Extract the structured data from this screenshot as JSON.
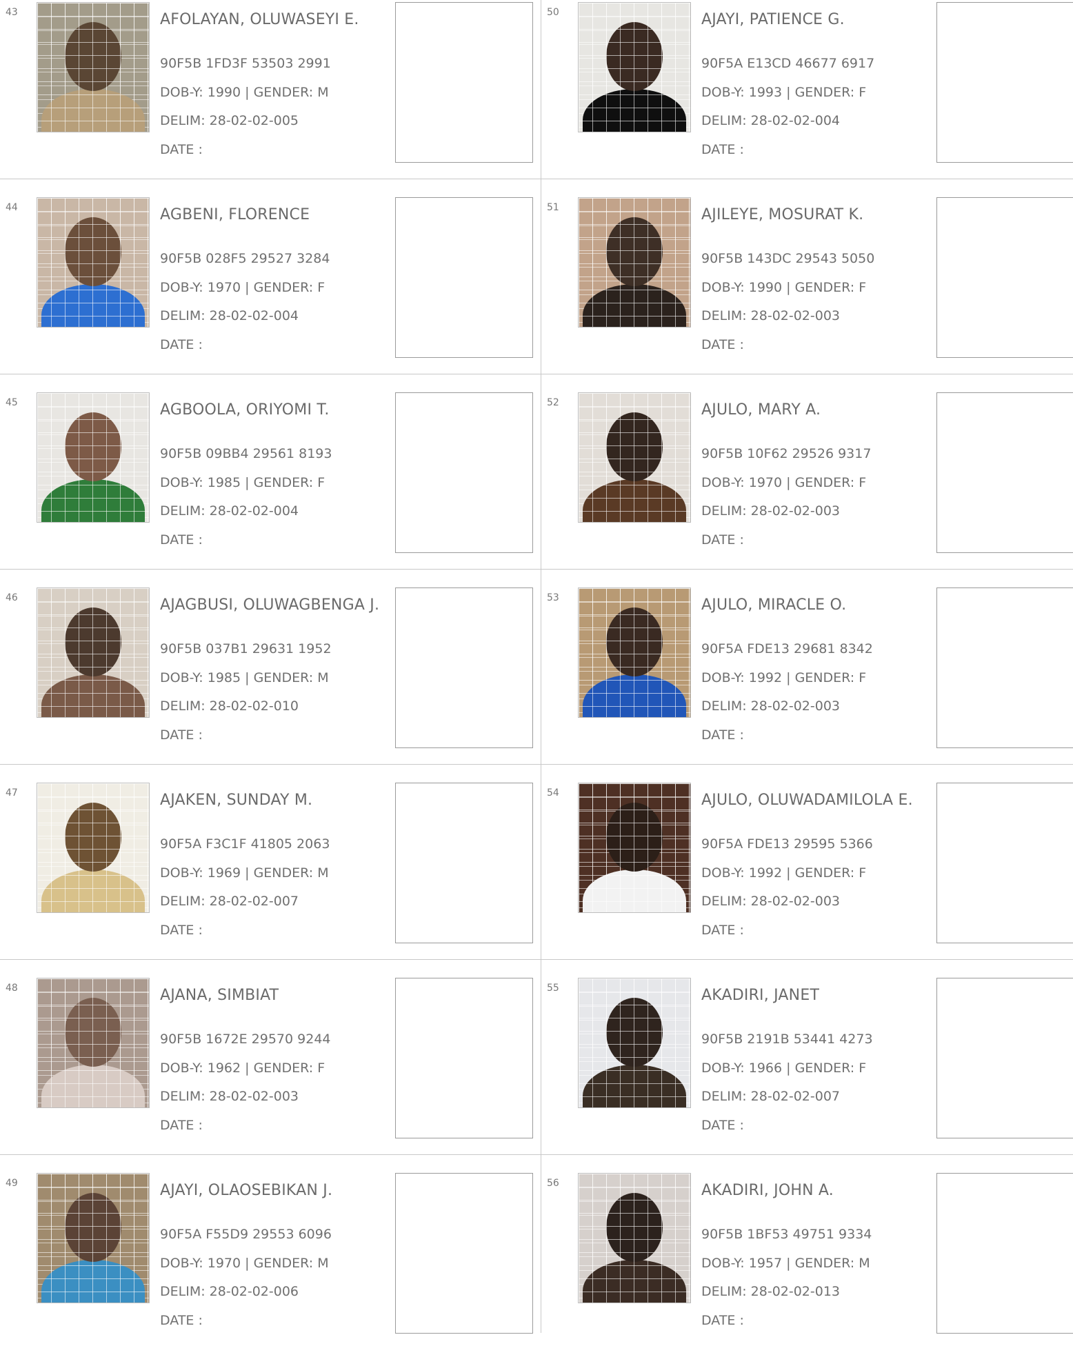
{
  "records": [
    {
      "num": "43",
      "name": "AFOLAYAN, OLUWASEYI E.",
      "vin": "90F5B 1FD3F 53503 2991",
      "dob": "DOB-Y: 1990  | GENDER: M",
      "delim": "DELIM: 28-02-02-005",
      "date": "DATE  :",
      "bg": "#a39c8a",
      "skin": "#5a4634",
      "cloth": "#b79f7a"
    },
    {
      "num": "44",
      "name": "AGBENI, FLORENCE",
      "vin": "90F5B 028F5 29527 3284",
      "dob": "DOB-Y: 1970  | GENDER: F",
      "delim": "DELIM: 28-02-02-004",
      "date": "DATE  :",
      "bg": "#c9b7a6",
      "skin": "#6b4f3b",
      "cloth": "#2d6fd1"
    },
    {
      "num": "45",
      "name": "AGBOOLA, ORIYOMI T.",
      "vin": "90F5B 09BB4 29561 8193",
      "dob": "DOB-Y: 1985  | GENDER: F",
      "delim": "DELIM: 28-02-02-004",
      "date": "DATE  :",
      "bg": "#e8e6e2",
      "skin": "#7d5a47",
      "cloth": "#2f7d3a"
    },
    {
      "num": "46",
      "name": "AJAGBUSI, OLUWAGBENGA J.",
      "vin": "90F5B 037B1 29631 1952",
      "dob": "DOB-Y: 1985  | GENDER: M",
      "delim": "DELIM: 28-02-02-010",
      "date": "DATE  :",
      "bg": "#d8cfc4",
      "skin": "#4c3a2e",
      "cloth": "#7a5a48"
    },
    {
      "num": "47",
      "name": "AJAKEN, SUNDAY M.",
      "vin": "90F5A F3C1F 41805 2063",
      "dob": "DOB-Y: 1969  | GENDER: M",
      "delim": "DELIM: 28-02-02-007",
      "date": "DATE  :",
      "bg": "#f0ede4",
      "skin": "#6e5234",
      "cloth": "#d8c18a"
    },
    {
      "num": "48",
      "name": "AJANA, SIMBIAT",
      "vin": "90F5B 1672E 29570 9244",
      "dob": "DOB-Y: 1962  | GENDER: F",
      "delim": "DELIM: 28-02-02-003",
      "date": "DATE  :",
      "bg": "#ab9a8f",
      "skin": "#7a5f50",
      "cloth": "#d8cbc4"
    },
    {
      "num": "49",
      "name": "AJAYI, OLAOSEBIKAN J.",
      "vin": "90F5A F55D9 29553 6096",
      "dob": "DOB-Y: 1970  | GENDER: M",
      "delim": "DELIM: 28-02-02-006",
      "date": "DATE  :",
      "bg": "#a08b6e",
      "skin": "#5b4336",
      "cloth": "#3b8fc2"
    },
    {
      "num": "50",
      "name": "AJAYI, PATIENCE G.",
      "vin": "90F5A E13CD 46677 6917",
      "dob": "DOB-Y: 1993  | GENDER: F",
      "delim": "DELIM: 28-02-02-004",
      "date": "DATE  :",
      "bg": "#e7e6e2",
      "skin": "#3a2a22",
      "cloth": "#0f0f0f"
    },
    {
      "num": "51",
      "name": "AJILEYE, MOSURAT K.",
      "vin": "90F5B 143DC 29543 5050",
      "dob": "DOB-Y: 1990  | GENDER: F",
      "delim": "DELIM: 28-02-02-003",
      "date": "DATE  :",
      "bg": "#c2a38a",
      "skin": "#3e2f26",
      "cloth": "#2b221d"
    },
    {
      "num": "52",
      "name": "AJULO, MARY A.",
      "vin": "90F5B 10F62 29526 9317",
      "dob": "DOB-Y: 1970  | GENDER: F",
      "delim": "DELIM: 28-02-02-003",
      "date": "DATE  :",
      "bg": "#e2ddd7",
      "skin": "#33261f",
      "cloth": "#5a3a25"
    },
    {
      "num": "53",
      "name": "AJULO, MIRACLE O.",
      "vin": "90F5A FDE13 29681 8342",
      "dob": "DOB-Y: 1992  | GENDER: F",
      "delim": "DELIM: 28-02-02-003",
      "date": "DATE  :",
      "bg": "#b89a74",
      "skin": "#3a2a22",
      "cloth": "#2156b8"
    },
    {
      "num": "54",
      "name": "AJULO, OLUWADAMILOLA E.",
      "vin": "90F5A FDE13 29595 5366",
      "dob": "DOB-Y: 1992  | GENDER: F",
      "delim": "DELIM: 28-02-02-003",
      "date": "DATE  :",
      "bg": "#4e3024",
      "skin": "#2c1f18",
      "cloth": "#f2f2f2"
    },
    {
      "num": "55",
      "name": "AKADIRI, JANET",
      "vin": "90F5B 2191B 53441 4273",
      "dob": "DOB-Y: 1966  | GENDER: F",
      "delim": "DELIM: 28-02-02-007",
      "date": "DATE  :",
      "bg": "#e6e7ea",
      "skin": "#2f241e",
      "cloth": "#3a2e24"
    },
    {
      "num": "56",
      "name": "AKADIRI, JOHN A.",
      "vin": "90F5B 1BF53 49751 9334",
      "dob": "DOB-Y: 1957  | GENDER: M",
      "delim": "DELIM: 28-02-02-013",
      "date": "DATE  :",
      "bg": "#d6d0cc",
      "skin": "#2c221d",
      "cloth": "#3b2c24"
    }
  ]
}
